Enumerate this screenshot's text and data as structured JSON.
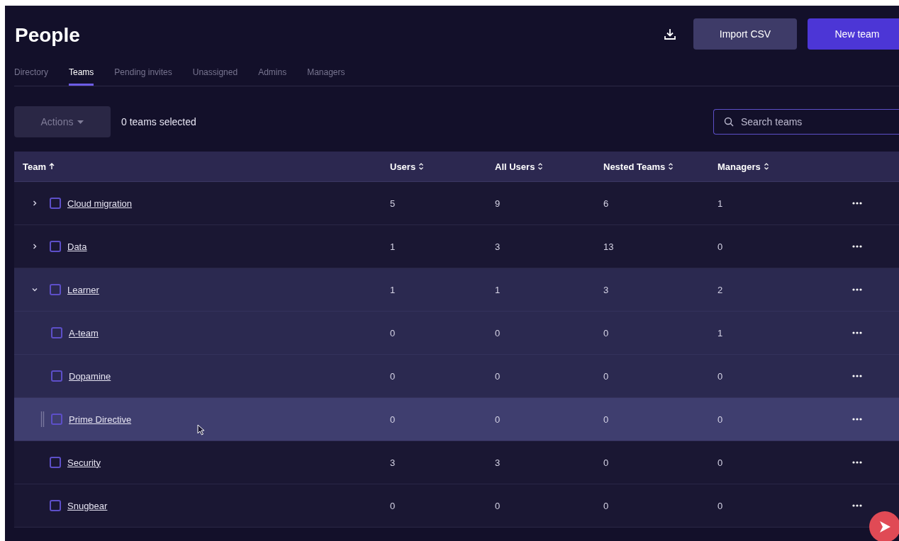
{
  "title": "People",
  "header_actions": {
    "import_label": "Import CSV",
    "new_label": "New team"
  },
  "tabs": [
    {
      "label": "Directory",
      "selected": false
    },
    {
      "label": "Teams",
      "selected": true
    },
    {
      "label": "Pending invites",
      "selected": false
    },
    {
      "label": "Unassigned",
      "selected": false
    },
    {
      "label": "Admins",
      "selected": false
    },
    {
      "label": "Managers",
      "selected": false
    }
  ],
  "toolbar": {
    "actions_label": "Actions",
    "selection_text": "0 teams selected",
    "search_placeholder": "Search teams"
  },
  "table": {
    "columns": [
      {
        "label": "Team",
        "sorted": true
      },
      {
        "label": "Users",
        "sorted": false
      },
      {
        "label": "All Users",
        "sorted": false
      },
      {
        "label": "Nested Teams",
        "sorted": false
      },
      {
        "label": "Managers",
        "sorted": false
      }
    ],
    "rows": [
      {
        "name": "Cloud migration",
        "users": "5",
        "all_users": "9",
        "nested_teams": "6",
        "managers": "1",
        "checked": false,
        "expanded": false,
        "hovered": false,
        "expandable": true
      },
      {
        "name": "Data",
        "users": "1",
        "all_users": "3",
        "nested_teams": "13",
        "managers": "0",
        "checked": false,
        "expanded": false,
        "hovered": false,
        "expandable": true
      },
      {
        "name": "Learner",
        "users": "1",
        "all_users": "1",
        "nested_teams": "3",
        "managers": "2",
        "checked": false,
        "expanded": true,
        "hovered": false,
        "expandable": true,
        "children": [
          {
            "name": "A-team",
            "users": "0",
            "all_users": "0",
            "nested_teams": "0",
            "managers": "1",
            "checked": false,
            "hovered": false
          },
          {
            "name": "Dopamine",
            "users": "0",
            "all_users": "0",
            "nested_teams": "0",
            "managers": "0",
            "checked": false,
            "hovered": false
          },
          {
            "name": "Prime Directive",
            "users": "0",
            "all_users": "0",
            "nested_teams": "0",
            "managers": "0",
            "checked": false,
            "hovered": true
          }
        ]
      },
      {
        "name": "Security",
        "users": "3",
        "all_users": "3",
        "nested_teams": "0",
        "managers": "0",
        "checked": false,
        "hovered": false,
        "expandable": false
      },
      {
        "name": "Snugbear",
        "users": "0",
        "all_users": "0",
        "nested_teams": "0",
        "managers": "0",
        "checked": false,
        "hovered": false,
        "expandable": false
      }
    ]
  }
}
